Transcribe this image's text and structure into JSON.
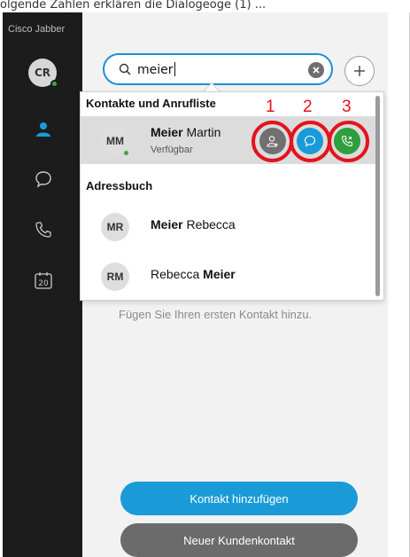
{
  "caption": "olgende Zahlen erklären die Dialogeoge (1) ...",
  "sidebar": {
    "brand": "Cisco Jabber",
    "avatar_initials": "CR",
    "presence_color": "#3aa84a",
    "items": [
      {
        "icon": "contacts-icon",
        "active": true
      },
      {
        "icon": "chat-icon"
      },
      {
        "icon": "phone-icon"
      },
      {
        "icon": "calendar-icon",
        "label": "20"
      }
    ]
  },
  "search": {
    "value": "meier",
    "clear_icon": "clear-icon",
    "add_icon": "plus-icon"
  },
  "dropdown": {
    "section_contacts": "Kontakte und Anrufliste",
    "section_addressbook": "Adressbuch",
    "contacts": [
      {
        "initials": "MM",
        "name_bold": "Meier",
        "name_rest": " Martin",
        "status": "Verfügbar"
      }
    ],
    "addressbook": [
      {
        "initials": "MR",
        "name_bold": "Meier",
        "name_rest": " Rebecca"
      },
      {
        "initials": "RM",
        "name_pre": "Rebecca ",
        "name_bold": "Meier"
      }
    ],
    "actions": [
      {
        "icon": "add-contact-icon",
        "color": "#707070",
        "number": "1"
      },
      {
        "icon": "chat-icon",
        "color": "#1a9bd7",
        "number": "2"
      },
      {
        "icon": "call-icon",
        "color": "#2e9e3e",
        "number": "3"
      }
    ]
  },
  "main": {
    "empty_text": "Fügen Sie Ihren ersten Kontakt hinzu.",
    "add_contact_label": "Kontakt hinzufügen",
    "new_customer_label": "Neuer Kundenkontakt",
    "primary_color": "#1a9bd7",
    "secondary_color": "#6b6b6b"
  },
  "annotation_color": "#e2141d"
}
